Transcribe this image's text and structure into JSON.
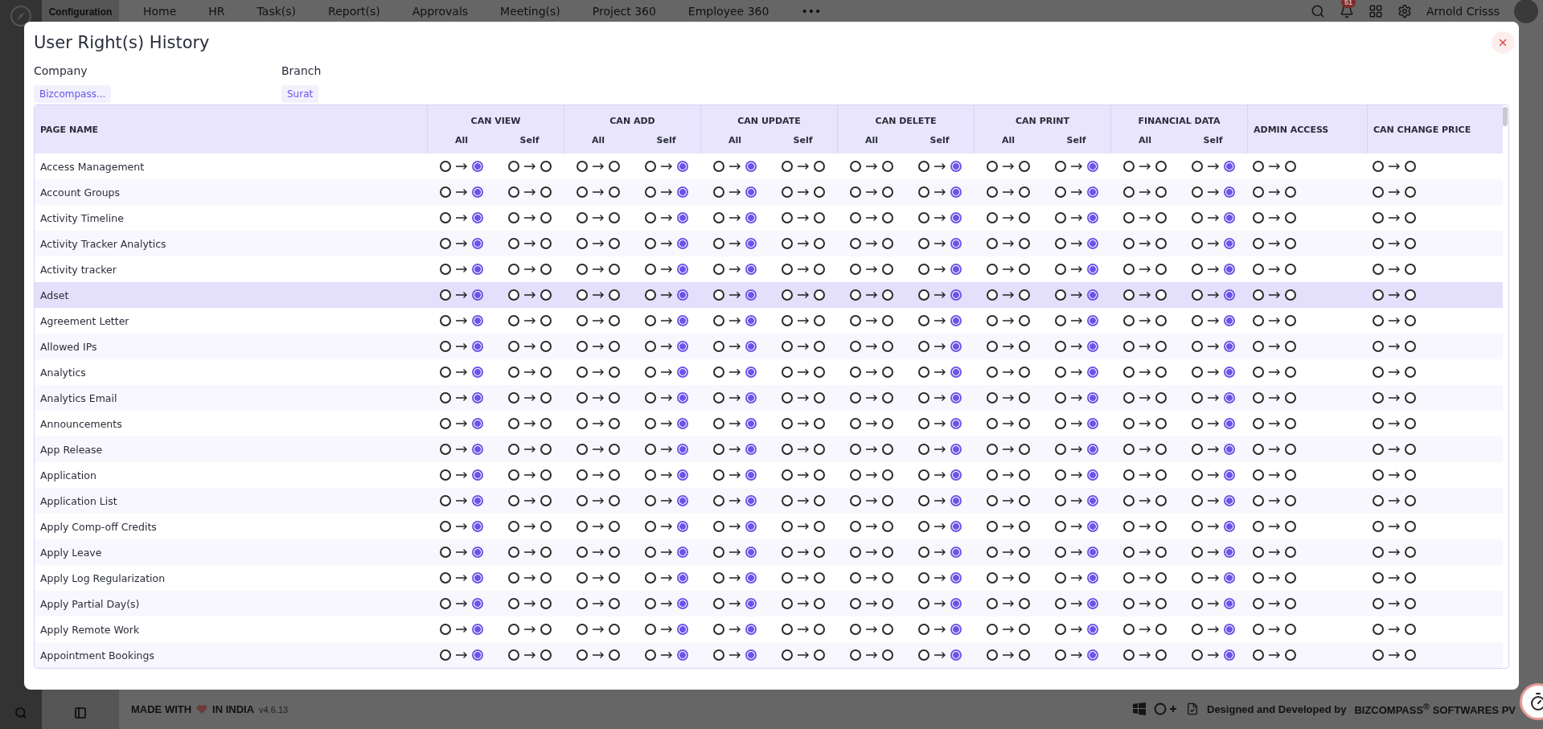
{
  "app": {
    "section": "Configuration",
    "nav": [
      "Home",
      "HR",
      "Task(s)",
      "Report(s)",
      "Approvals",
      "Meeting(s)",
      "Project 360",
      "Employee 360",
      "•••"
    ],
    "notification_count": "51",
    "user": "Arnold Crisss"
  },
  "footer": {
    "made_with": "MADE WITH",
    "in_india": "IN INDIA",
    "version": "v4.6.13",
    "credit": "Designed and Developed by",
    "brand": "BIZCOMPASS",
    "brand_mark": "®",
    "brand_rest": "SOFTWARES PV"
  },
  "modal": {
    "title": "User Right(s) History",
    "filters": [
      {
        "label": "Company",
        "value": "Bizcompass..."
      },
      {
        "label": "Branch",
        "value": "Surat"
      }
    ]
  },
  "table": {
    "name_column": "PAGE NAME",
    "columns": [
      {
        "label": "CAN VIEW",
        "sub": [
          "All",
          "Self"
        ]
      },
      {
        "label": "CAN ADD",
        "sub": [
          "All",
          "Self"
        ]
      },
      {
        "label": "CAN UPDATE",
        "sub": [
          "All",
          "Self"
        ]
      },
      {
        "label": "CAN DELETE",
        "sub": [
          "All",
          "Self"
        ]
      },
      {
        "label": "CAN PRINT",
        "sub": [
          "All",
          "Self"
        ]
      },
      {
        "label": "FINANCIAL DATA",
        "sub": [
          "All",
          "Self"
        ]
      },
      {
        "label": "ADMIN ACCESS"
      },
      {
        "label": "CAN CHANGE PRICE"
      }
    ],
    "rows": [
      {
        "name": "Access Management",
        "selected": false,
        "cells": [
          [
            false,
            true
          ],
          [
            false,
            false
          ],
          [
            false,
            false
          ],
          [
            false,
            true
          ],
          [
            false,
            true
          ],
          [
            false,
            false
          ],
          [
            false,
            false
          ],
          [
            false,
            true
          ],
          [
            false,
            false
          ],
          [
            false,
            true
          ],
          [
            false,
            false
          ],
          [
            false,
            true
          ],
          [
            false,
            false
          ],
          [
            false,
            false
          ]
        ]
      },
      {
        "name": "Account Groups",
        "selected": false,
        "cells": [
          [
            false,
            true
          ],
          [
            false,
            false
          ],
          [
            false,
            false
          ],
          [
            false,
            true
          ],
          [
            false,
            true
          ],
          [
            false,
            false
          ],
          [
            false,
            false
          ],
          [
            false,
            true
          ],
          [
            false,
            false
          ],
          [
            false,
            true
          ],
          [
            false,
            false
          ],
          [
            false,
            true
          ],
          [
            false,
            false
          ],
          [
            false,
            false
          ]
        ]
      },
      {
        "name": "Activity Timeline",
        "selected": false,
        "cells": [
          [
            false,
            true
          ],
          [
            false,
            false
          ],
          [
            false,
            false
          ],
          [
            false,
            true
          ],
          [
            false,
            true
          ],
          [
            false,
            false
          ],
          [
            false,
            false
          ],
          [
            false,
            true
          ],
          [
            false,
            false
          ],
          [
            false,
            true
          ],
          [
            false,
            false
          ],
          [
            false,
            true
          ],
          [
            false,
            false
          ],
          [
            false,
            false
          ]
        ]
      },
      {
        "name": "Activity Tracker Analytics",
        "selected": false,
        "cells": [
          [
            false,
            true
          ],
          [
            false,
            false
          ],
          [
            false,
            false
          ],
          [
            false,
            true
          ],
          [
            false,
            true
          ],
          [
            false,
            false
          ],
          [
            false,
            false
          ],
          [
            false,
            true
          ],
          [
            false,
            false
          ],
          [
            false,
            true
          ],
          [
            false,
            false
          ],
          [
            false,
            true
          ],
          [
            false,
            false
          ],
          [
            false,
            false
          ]
        ]
      },
      {
        "name": "Activity tracker",
        "selected": false,
        "cells": [
          [
            false,
            true
          ],
          [
            false,
            false
          ],
          [
            false,
            false
          ],
          [
            false,
            true
          ],
          [
            false,
            true
          ],
          [
            false,
            false
          ],
          [
            false,
            false
          ],
          [
            false,
            true
          ],
          [
            false,
            false
          ],
          [
            false,
            true
          ],
          [
            false,
            false
          ],
          [
            false,
            true
          ],
          [
            false,
            false
          ],
          [
            false,
            false
          ]
        ]
      },
      {
        "name": "Adset",
        "selected": true,
        "cells": [
          [
            false,
            true
          ],
          [
            false,
            false
          ],
          [
            false,
            false
          ],
          [
            false,
            true
          ],
          [
            false,
            true
          ],
          [
            false,
            false
          ],
          [
            false,
            false
          ],
          [
            false,
            true
          ],
          [
            false,
            false
          ],
          [
            false,
            true
          ],
          [
            false,
            false
          ],
          [
            false,
            true
          ],
          [
            false,
            false
          ],
          [
            false,
            false
          ]
        ]
      },
      {
        "name": "Agreement Letter",
        "selected": false,
        "cells": [
          [
            false,
            true
          ],
          [
            false,
            false
          ],
          [
            false,
            false
          ],
          [
            false,
            true
          ],
          [
            false,
            true
          ],
          [
            false,
            false
          ],
          [
            false,
            false
          ],
          [
            false,
            true
          ],
          [
            false,
            false
          ],
          [
            false,
            true
          ],
          [
            false,
            false
          ],
          [
            false,
            true
          ],
          [
            false,
            false
          ],
          [
            false,
            false
          ]
        ]
      },
      {
        "name": "Allowed IPs",
        "selected": false,
        "cells": [
          [
            false,
            true
          ],
          [
            false,
            false
          ],
          [
            false,
            false
          ],
          [
            false,
            true
          ],
          [
            false,
            true
          ],
          [
            false,
            false
          ],
          [
            false,
            false
          ],
          [
            false,
            true
          ],
          [
            false,
            false
          ],
          [
            false,
            true
          ],
          [
            false,
            false
          ],
          [
            false,
            true
          ],
          [
            false,
            false
          ],
          [
            false,
            false
          ]
        ]
      },
      {
        "name": "Analytics",
        "selected": false,
        "cells": [
          [
            false,
            true
          ],
          [
            false,
            false
          ],
          [
            false,
            false
          ],
          [
            false,
            true
          ],
          [
            false,
            true
          ],
          [
            false,
            false
          ],
          [
            false,
            false
          ],
          [
            false,
            true
          ],
          [
            false,
            false
          ],
          [
            false,
            true
          ],
          [
            false,
            false
          ],
          [
            false,
            true
          ],
          [
            false,
            false
          ],
          [
            false,
            false
          ]
        ]
      },
      {
        "name": "Analytics Email",
        "selected": false,
        "cells": [
          [
            false,
            true
          ],
          [
            false,
            false
          ],
          [
            false,
            false
          ],
          [
            false,
            true
          ],
          [
            false,
            true
          ],
          [
            false,
            false
          ],
          [
            false,
            false
          ],
          [
            false,
            true
          ],
          [
            false,
            false
          ],
          [
            false,
            true
          ],
          [
            false,
            false
          ],
          [
            false,
            true
          ],
          [
            false,
            false
          ],
          [
            false,
            false
          ]
        ]
      },
      {
        "name": "Announcements",
        "selected": false,
        "cells": [
          [
            false,
            true
          ],
          [
            false,
            false
          ],
          [
            false,
            false
          ],
          [
            false,
            true
          ],
          [
            false,
            true
          ],
          [
            false,
            false
          ],
          [
            false,
            false
          ],
          [
            false,
            true
          ],
          [
            false,
            false
          ],
          [
            false,
            true
          ],
          [
            false,
            false
          ],
          [
            false,
            true
          ],
          [
            false,
            false
          ],
          [
            false,
            false
          ]
        ]
      },
      {
        "name": "App Release",
        "selected": false,
        "cells": [
          [
            false,
            true
          ],
          [
            false,
            false
          ],
          [
            false,
            false
          ],
          [
            false,
            true
          ],
          [
            false,
            true
          ],
          [
            false,
            false
          ],
          [
            false,
            false
          ],
          [
            false,
            true
          ],
          [
            false,
            false
          ],
          [
            false,
            true
          ],
          [
            false,
            false
          ],
          [
            false,
            true
          ],
          [
            false,
            false
          ],
          [
            false,
            false
          ]
        ]
      },
      {
        "name": "Application",
        "selected": false,
        "cells": [
          [
            false,
            true
          ],
          [
            false,
            false
          ],
          [
            false,
            false
          ],
          [
            false,
            true
          ],
          [
            false,
            true
          ],
          [
            false,
            false
          ],
          [
            false,
            false
          ],
          [
            false,
            true
          ],
          [
            false,
            false
          ],
          [
            false,
            true
          ],
          [
            false,
            false
          ],
          [
            false,
            true
          ],
          [
            false,
            false
          ],
          [
            false,
            false
          ]
        ]
      },
      {
        "name": "Application List",
        "selected": false,
        "cells": [
          [
            false,
            true
          ],
          [
            false,
            false
          ],
          [
            false,
            false
          ],
          [
            false,
            true
          ],
          [
            false,
            true
          ],
          [
            false,
            false
          ],
          [
            false,
            false
          ],
          [
            false,
            true
          ],
          [
            false,
            false
          ],
          [
            false,
            true
          ],
          [
            false,
            false
          ],
          [
            false,
            true
          ],
          [
            false,
            false
          ],
          [
            false,
            false
          ]
        ]
      },
      {
        "name": "Apply Comp-off Credits",
        "selected": false,
        "cells": [
          [
            false,
            true
          ],
          [
            false,
            false
          ],
          [
            false,
            false
          ],
          [
            false,
            true
          ],
          [
            false,
            true
          ],
          [
            false,
            false
          ],
          [
            false,
            false
          ],
          [
            false,
            true
          ],
          [
            false,
            false
          ],
          [
            false,
            true
          ],
          [
            false,
            false
          ],
          [
            false,
            true
          ],
          [
            false,
            false
          ],
          [
            false,
            false
          ]
        ]
      },
      {
        "name": "Apply Leave",
        "selected": false,
        "cells": [
          [
            false,
            true
          ],
          [
            false,
            false
          ],
          [
            false,
            false
          ],
          [
            false,
            true
          ],
          [
            false,
            true
          ],
          [
            false,
            false
          ],
          [
            false,
            false
          ],
          [
            false,
            true
          ],
          [
            false,
            false
          ],
          [
            false,
            true
          ],
          [
            false,
            false
          ],
          [
            false,
            true
          ],
          [
            false,
            false
          ],
          [
            false,
            false
          ]
        ]
      },
      {
        "name": "Apply Log Regularization",
        "selected": false,
        "cells": [
          [
            false,
            true
          ],
          [
            false,
            false
          ],
          [
            false,
            false
          ],
          [
            false,
            true
          ],
          [
            false,
            true
          ],
          [
            false,
            false
          ],
          [
            false,
            false
          ],
          [
            false,
            true
          ],
          [
            false,
            false
          ],
          [
            false,
            true
          ],
          [
            false,
            false
          ],
          [
            false,
            true
          ],
          [
            false,
            false
          ],
          [
            false,
            false
          ]
        ]
      },
      {
        "name": "Apply Partial Day(s)",
        "selected": false,
        "cells": [
          [
            false,
            true
          ],
          [
            false,
            false
          ],
          [
            false,
            false
          ],
          [
            false,
            true
          ],
          [
            false,
            true
          ],
          [
            false,
            false
          ],
          [
            false,
            false
          ],
          [
            false,
            true
          ],
          [
            false,
            false
          ],
          [
            false,
            true
          ],
          [
            false,
            false
          ],
          [
            false,
            true
          ],
          [
            false,
            false
          ],
          [
            false,
            false
          ]
        ]
      },
      {
        "name": "Apply Remote Work",
        "selected": false,
        "cells": [
          [
            false,
            true
          ],
          [
            false,
            false
          ],
          [
            false,
            false
          ],
          [
            false,
            true
          ],
          [
            false,
            true
          ],
          [
            false,
            false
          ],
          [
            false,
            false
          ],
          [
            false,
            true
          ],
          [
            false,
            false
          ],
          [
            false,
            true
          ],
          [
            false,
            false
          ],
          [
            false,
            true
          ],
          [
            false,
            false
          ],
          [
            false,
            false
          ]
        ]
      },
      {
        "name": "Appointment Bookings",
        "selected": false,
        "cells": [
          [
            false,
            true
          ],
          [
            false,
            false
          ],
          [
            false,
            false
          ],
          [
            false,
            true
          ],
          [
            false,
            true
          ],
          [
            false,
            false
          ],
          [
            false,
            false
          ],
          [
            false,
            true
          ],
          [
            false,
            false
          ],
          [
            false,
            true
          ],
          [
            false,
            false
          ],
          [
            false,
            true
          ],
          [
            false,
            false
          ],
          [
            false,
            false
          ]
        ]
      }
    ]
  }
}
